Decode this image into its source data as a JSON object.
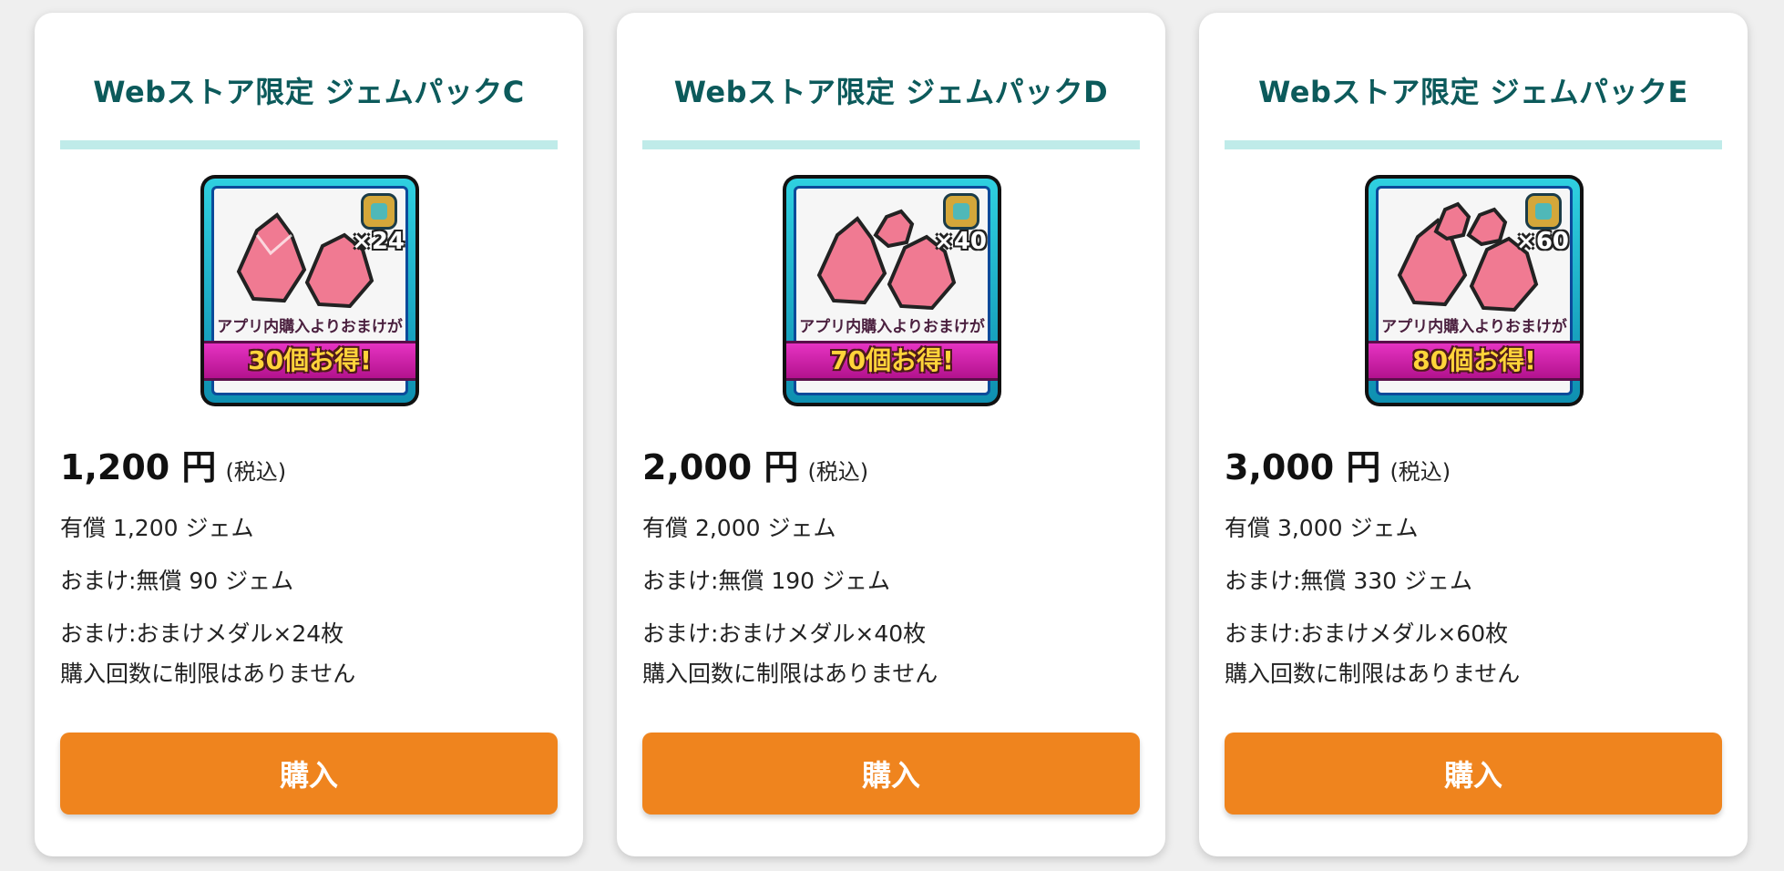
{
  "products": [
    {
      "title": "Webストア限定 ジェムパックC",
      "multiplier": "×24",
      "app_note": "アプリ内購入よりおまけが",
      "ribbon": "30個お得!",
      "price": "1,200 円",
      "tax": "(税込)",
      "paid_gems": "有償 1,200 ジェム",
      "bonus_gems": "おまけ:無償 90 ジェム",
      "bonus_medals": "おまけ:おまけメダル×24枚",
      "limit": "購入回数に制限はありません",
      "buy_label": "購入"
    },
    {
      "title": "Webストア限定 ジェムパックD",
      "multiplier": "×40",
      "app_note": "アプリ内購入よりおまけが",
      "ribbon": "70個お得!",
      "price": "2,000 円",
      "tax": "(税込)",
      "paid_gems": "有償 2,000 ジェム",
      "bonus_gems": "おまけ:無償 190 ジェム",
      "bonus_medals": "おまけ:おまけメダル×40枚",
      "limit": "購入回数に制限はありません",
      "buy_label": "購入"
    },
    {
      "title": "Webストア限定 ジェムパックE",
      "multiplier": "×60",
      "app_note": "アプリ内購入よりおまけが",
      "ribbon": "80個お得!",
      "price": "3,000 円",
      "tax": "(税込)",
      "paid_gems": "有償 3,000 ジェム",
      "bonus_gems": "おまけ:無償 330 ジェム",
      "bonus_medals": "おまけ:おまけメダル×60枚",
      "limit": "購入回数に制限はありません",
      "buy_label": "購入"
    }
  ],
  "colors": {
    "title": "#0c5a5b",
    "divider": "#bfebe9",
    "button": "#ef841e",
    "ribbon": "#d21fae",
    "gem": "#f07a92"
  }
}
